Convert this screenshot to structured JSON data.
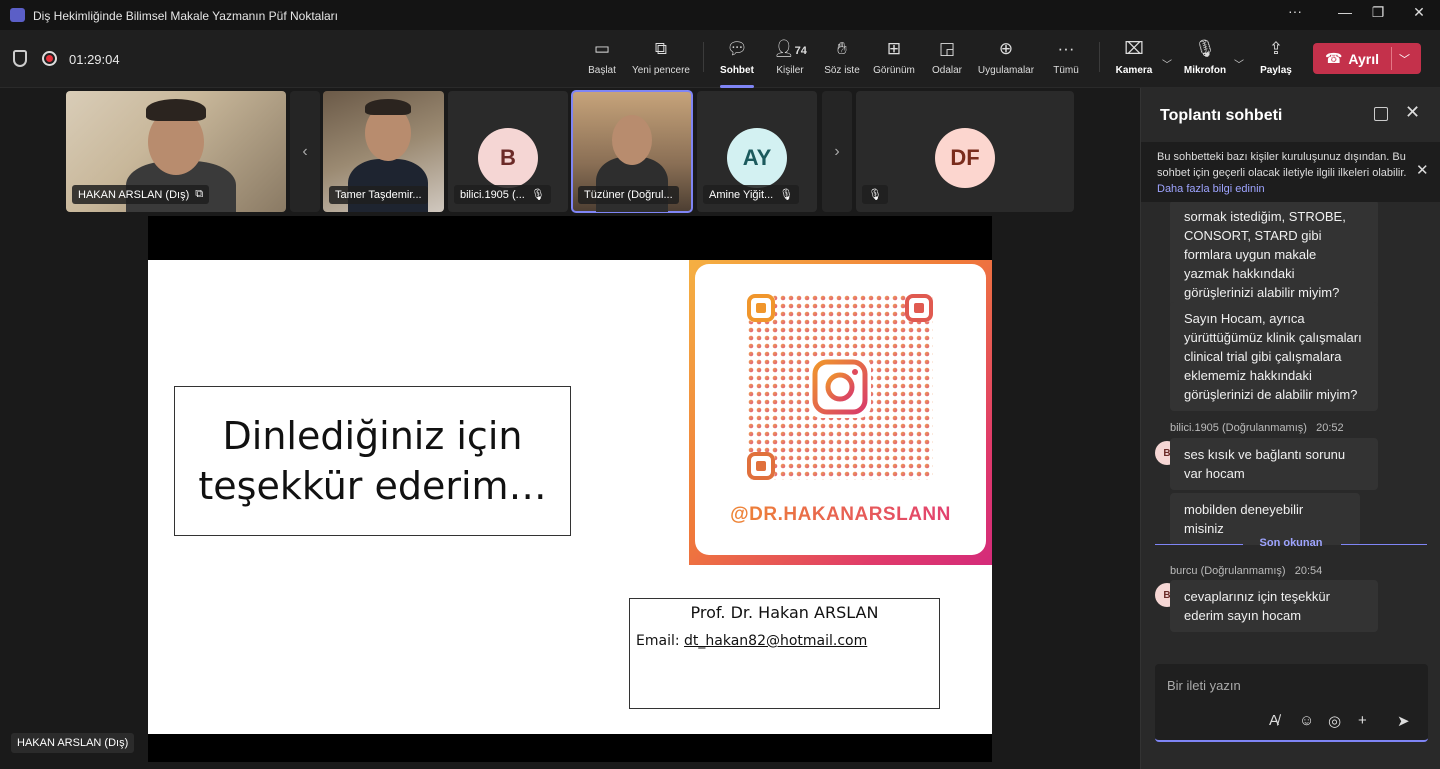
{
  "window": {
    "title": "Diş Hekimliğinde Bilimsel Makale Yazmanın Püf Noktaları",
    "controls": [
      "···",
      "—",
      "❐",
      "✕"
    ]
  },
  "meeting": {
    "timer": "01:29:04"
  },
  "toolbar": {
    "buttons": [
      {
        "label": "Başlat",
        "icon": "share-screen-icon"
      },
      {
        "label": "Yeni pencere",
        "icon": "new-window-icon"
      },
      {
        "label": "Sohbet",
        "icon": "chat-icon"
      },
      {
        "label": "Kişiler",
        "icon": "people-icon",
        "count": "74"
      },
      {
        "label": "Söz iste",
        "icon": "raise-hand-icon"
      },
      {
        "label": "Görünüm",
        "icon": "view-icon"
      },
      {
        "label": "Odalar",
        "icon": "rooms-icon"
      },
      {
        "label": "Uygulamalar",
        "icon": "apps-icon"
      },
      {
        "label": "Tümü",
        "icon": "more-icon"
      },
      {
        "label": "Kamera",
        "icon": "camera-off-icon"
      },
      {
        "label": "Mikrofon",
        "icon": "mic-off-icon"
      },
      {
        "label": "Paylaş",
        "icon": "share-icon"
      }
    ],
    "leave_label": "Ayrıl",
    "accent": "#7f85f5",
    "leave_color": "#c4314b"
  },
  "participants": [
    {
      "name": "HAKAN ARSLAN (Dış)",
      "type": "video"
    },
    {
      "name": "Tamer Taşdemir...",
      "type": "video"
    },
    {
      "name": "bilici.1905 (...",
      "type": "avatar",
      "initials": "B",
      "muted": true
    },
    {
      "name": "Tüzüner (Doğrul...",
      "type": "video",
      "selected": true
    },
    {
      "name": "Amine Yiğit...",
      "type": "avatar",
      "initials": "AY",
      "muted": true
    },
    {
      "name": "",
      "type": "avatar",
      "initials": "DF",
      "muted": true
    }
  ],
  "slide": {
    "thanks_line1": "Dinlediğiniz için",
    "thanks_line2": "teşekkür ederim…",
    "instagram_handle": "@DR.HAKANARSLANN",
    "contact_name": "Prof. Dr. Hakan ARSLAN",
    "email_label": "Email:",
    "email": "dt_hakan82@hotmail.com"
  },
  "speaker_label": "HAKAN ARSLAN (Dış)",
  "chat": {
    "title": "Toplantı sohbeti",
    "notice_text": "Bu sohbetteki bazı kişiler kuruluşunuz dışından. Bu sohbet için geçerli olacak iletiyle ilgili ilkeleri olabilir.",
    "notice_link": "Daha fazla bilgi edinin",
    "messages": [
      {
        "text": "sormak istediğim, STROBE, CONSORT, STARD gibi formlara uygun makale yazmak hakkındaki görüşlerinizi alabilir miyim?"
      },
      {
        "text": "Sayın Hocam, ayrıca yürüttüğümüz klinik çalışmaları clinical trial gibi çalışmalara eklememiz hakkındaki görüşlerinizi de alabilir miyim?"
      },
      {
        "sender": "bilici.1905 (Doğrulanmamış)",
        "time": "20:52",
        "initial": "B",
        "text": "ses kısık ve bağlantı sorunu var hocam"
      },
      {
        "text": "mobilden deneyebilir misiniz"
      },
      {
        "sender": "burcu (Doğrulanmamış)",
        "time": "20:54",
        "initial": "B",
        "text": "cevaplarınız için teşekkür ederim sayın hocam"
      }
    ],
    "last_read": "Son okunan",
    "compose_placeholder": "Bir ileti yazın"
  }
}
